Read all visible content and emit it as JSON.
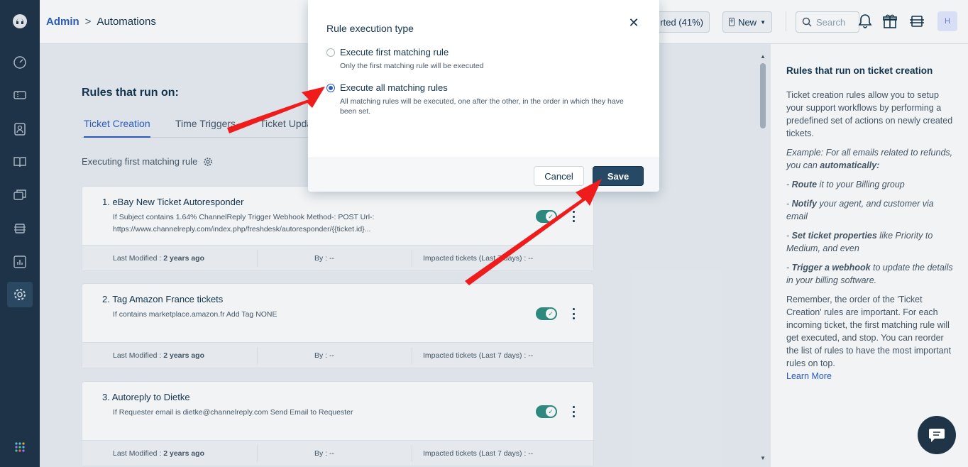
{
  "breadcrumb": {
    "parent": "Admin",
    "separator": ">",
    "current": "Automations"
  },
  "header": {
    "trial_label": "rted (41%)",
    "new_label": "New",
    "search_placeholder": "Search",
    "avatar_initial": "H"
  },
  "main": {
    "title": "Rules that run on:",
    "tabs": [
      {
        "label": "Ticket Creation",
        "active": true
      },
      {
        "label": "Time Triggers",
        "active": false
      },
      {
        "label": "Ticket Upda",
        "active": false
      }
    ],
    "executing_label": "Executing first matching rule"
  },
  "rules": [
    {
      "title": "1.  eBay New Ticket Autoresponder",
      "desc": "If Subject contains 1.64% ChannelReply Trigger Webhook Method-: POST Url-: https://www.channelreply.com/index.php/freshdesk/autoresponder/{{ticket.id}...",
      "enabled": true,
      "last_modified_label": "Last Modified :",
      "last_modified": "2 years ago",
      "by_label": "By : --",
      "impacted_label": "Impacted tickets (Last 7 days) : --"
    },
    {
      "title": "2.  Tag Amazon France tickets",
      "desc": "If contains marketplace.amazon.fr Add Tag NONE",
      "enabled": true,
      "last_modified_label": "Last Modified :",
      "last_modified": "2 years ago",
      "by_label": "By : --",
      "impacted_label": "Impacted tickets (Last 7 days) : --"
    },
    {
      "title": "3.  Autoreply to Dietke",
      "desc": "If Requester email is dietke@channelreply.com Send Email to Requester",
      "enabled": true,
      "last_modified_label": "Last Modified :",
      "last_modified": "2 years ago",
      "by_label": "By : --",
      "impacted_label": "Impacted tickets (Last 7 days) : --"
    }
  ],
  "right_panel": {
    "title": "Rules that run on ticket creation",
    "intro": "Ticket creation rules allow you to setup your support workflows by performing a predefined set of actions on newly created tickets.",
    "example_prefix": "Example: For all emails related to refunds, you can ",
    "example_bold": "automatically:",
    "items": [
      {
        "dash": "- ",
        "bold": "Route",
        "rest": " it to your Billing group"
      },
      {
        "dash": "- ",
        "bold": "Notify",
        "rest": " your agent, and customer via email"
      },
      {
        "dash": "- ",
        "bold": "Set ticket properties",
        "rest": " like Priority to Medium, and even"
      },
      {
        "dash": "- ",
        "bold": "Trigger a webhook",
        "rest": " to update the details in your billing software."
      }
    ],
    "remember": "Remember, the order of the 'Ticket Creation' rules are important. For each incoming ticket, the first matching rule will get executed, and stop. You can reorder the list of rules to have the most important rules on top.",
    "learn_more": "Learn More"
  },
  "modal": {
    "title": "Rule execution type",
    "options": [
      {
        "label": "Execute first matching rule",
        "desc": "Only the first matching rule will be executed",
        "selected": false
      },
      {
        "label": "Execute all matching rules",
        "desc": "All matching rules will be executed, one after the other, in the order in which they have been set.",
        "selected": true
      }
    ],
    "cancel_label": "Cancel",
    "save_label": "Save"
  },
  "colors": {
    "nav_bg": "#1f3447",
    "primary_link": "#2c5cc5",
    "save_button": "#264966",
    "toggle_on": "#2f8e80",
    "annotation_arrow": "#f01c1c"
  },
  "icons": [
    "headset-logo-icon",
    "dashboard-icon",
    "tickets-icon",
    "contacts-icon",
    "solutions-icon",
    "forums-icon",
    "social-icon",
    "reports-icon",
    "admin-gear-icon",
    "apps-grid-icon",
    "plus-square-icon",
    "search-icon",
    "bell-icon",
    "gift-icon",
    "support-icon",
    "gear-icon",
    "close-icon",
    "chat-icon"
  ]
}
